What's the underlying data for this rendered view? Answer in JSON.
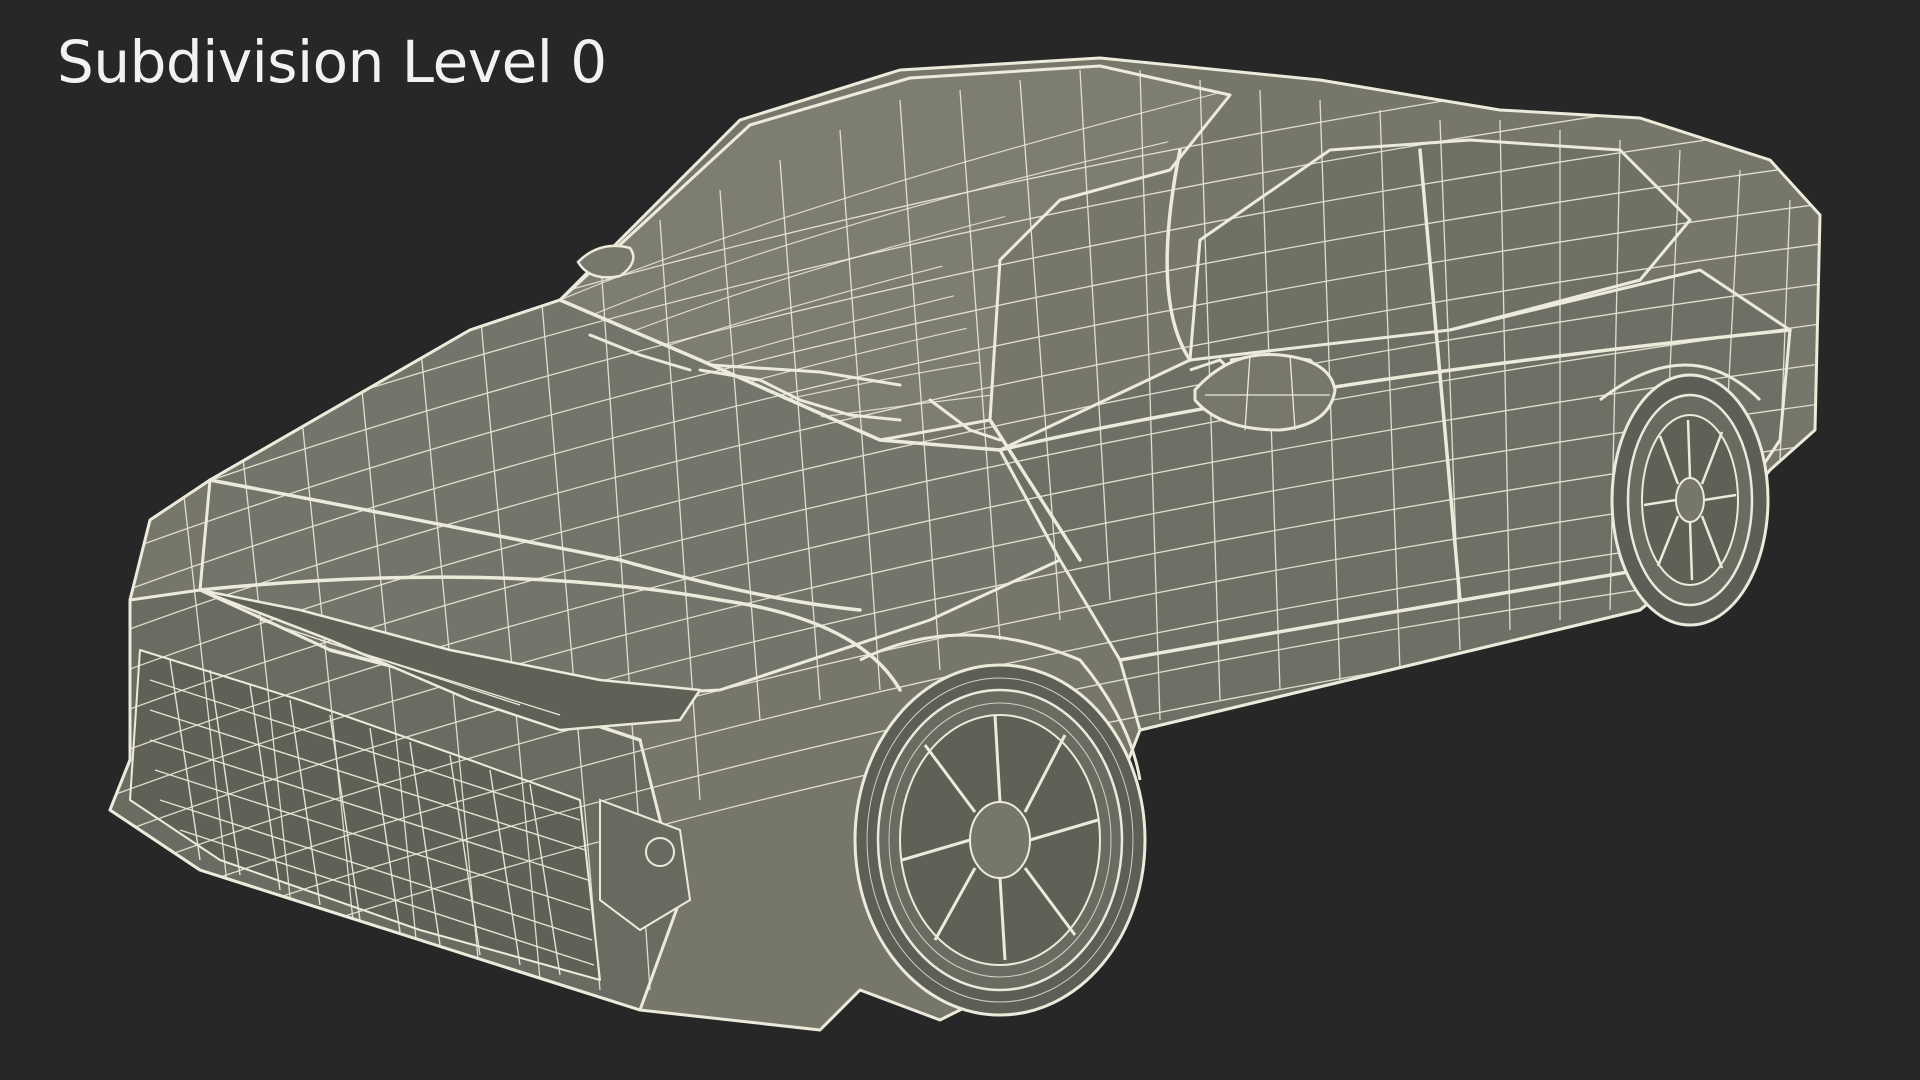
{
  "caption": "Subdivision Level 0",
  "colors": {
    "background": "#272727",
    "surface": "#76776a",
    "surface_dark": "#5f6056",
    "wire": "#eceadb",
    "caption": "#f2f2f2"
  }
}
